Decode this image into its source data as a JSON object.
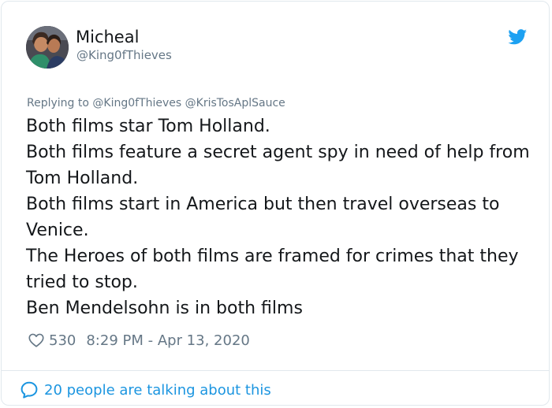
{
  "user": {
    "display_name": "Micheal",
    "handle": "@King0fThieves"
  },
  "reply": {
    "prefix": "Replying to",
    "mentions": [
      "@King0fThieves",
      "@KrisTosAplSauce"
    ]
  },
  "tweet": {
    "lines": [
      "Both films star Tom Holland.",
      "Both films feature a secret agent spy in need of help from Tom Holland.",
      "Both films start in America but then travel overseas to Venice.",
      "The Heroes of both films are framed for crimes that they tried to stop.",
      "Ben Mendelsohn is in both films"
    ]
  },
  "meta": {
    "likes": "530",
    "timestamp": "8:29 PM - Apr 13, 2020"
  },
  "footer": {
    "talking": "20 people are talking about this"
  },
  "icons": {
    "logo": "twitter-bird-icon",
    "like": "heart-icon",
    "conversation": "speech-bubble-icon"
  },
  "colors": {
    "brand": "#1da1f2",
    "link": "#1b95e0",
    "text": "#14171a",
    "muted": "#657786",
    "border": "#e1e8ed"
  }
}
